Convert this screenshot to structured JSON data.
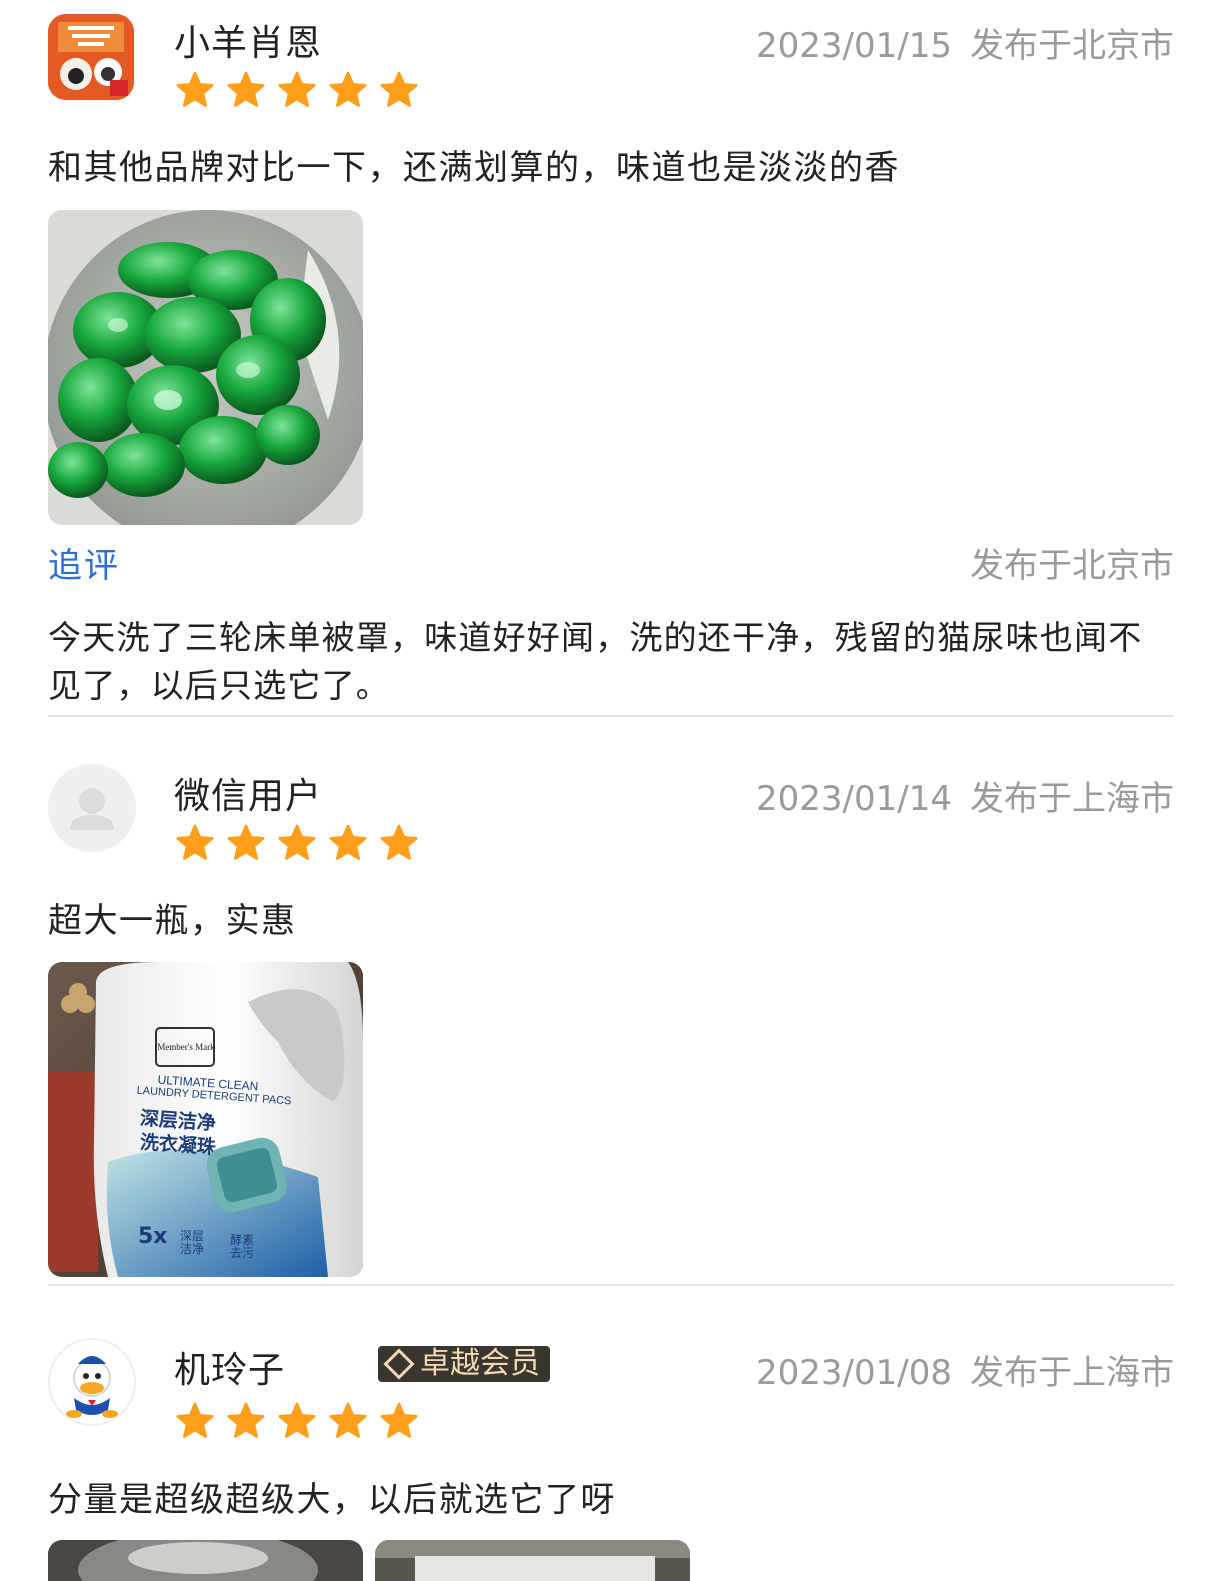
{
  "reviews": [
    {
      "username": "小羊肖恩",
      "avatar_icon": "shaun-the-sheep-avatar",
      "date": "2023/01/15",
      "location": "发布于北京市",
      "rating": 5,
      "text": "和其他品牌对比一下，还满划算的，味道也是淡淡的香",
      "followup": {
        "label": "追评",
        "location": "发布于北京市",
        "text": "今天洗了三轮床单被罩，味道好好闻，洗的还干净，残留的猫尿味也闻不见了，以后只选它了。"
      }
    },
    {
      "username": "微信用户",
      "avatar_icon": "default-user-avatar",
      "date": "2023/01/14",
      "location": "发布于上海市",
      "rating": 5,
      "text": "超大一瓶，实惠",
      "product_photo": {
        "brand": "Member's Mark",
        "line1": "ULTIMATE CLEAN",
        "line2": "LAUNDRY DETERGENT PACS",
        "cn1": "深层洁净",
        "cn2": "洗衣凝珠",
        "tag_5x": "5x",
        "tag_deep": "深层洁净",
        "tag_enzyme": "酵素去污"
      }
    },
    {
      "username": "机玲子",
      "avatar_icon": "donald-duck-avatar",
      "badge": "卓越会员",
      "date": "2023/01/08",
      "location": "发布于上海市",
      "rating": 5,
      "text": "分量是超级超级大，以后就选它了呀"
    }
  ],
  "colors": {
    "star": "#ff9e1b",
    "link_blue": "#2a6fcf",
    "meta_gray": "#9a9a9a",
    "badge_bg": "#3b3530",
    "badge_text": "#f1d9b6"
  }
}
